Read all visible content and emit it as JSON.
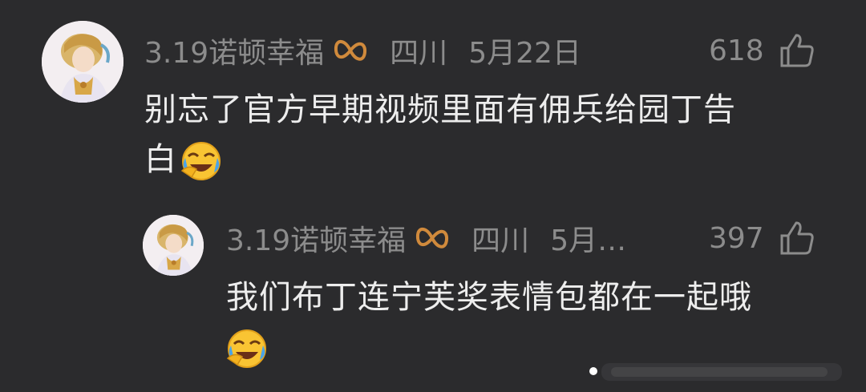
{
  "comments": [
    {
      "username": "3.19诺顿幸福",
      "badge_icon": "infinity-badge-icon",
      "location": "四川",
      "date": "5月22日",
      "likes": "618",
      "text_line1": "别忘了官方早期视频里面有佣兵给园丁告",
      "text_line2": "白",
      "emoji": "crying-laughing-emoji"
    },
    {
      "username": "3.19诺顿幸福",
      "badge_icon": "infinity-badge-icon",
      "location": "四川",
      "date": "5月…",
      "likes": "397",
      "text_line1": "我们布丁连宁芙奖表情包都在一起哦",
      "emoji": "crying-laughing-emoji"
    }
  ],
  "colors": {
    "background": "#2b2b2d",
    "meta_text": "#8c8c8c",
    "body_text": "#ededed",
    "badge": "#d08a3c"
  }
}
